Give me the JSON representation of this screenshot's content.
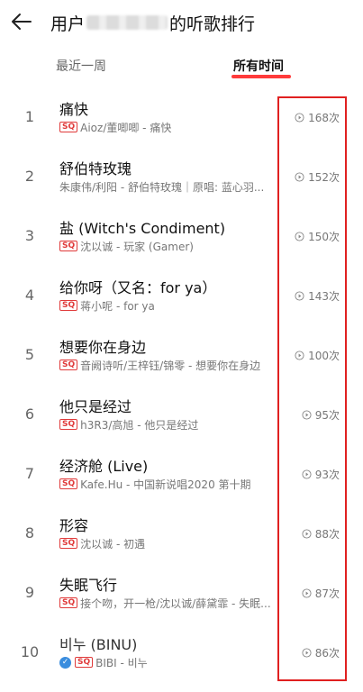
{
  "header": {
    "title_prefix": "用户",
    "title_suffix": "的听歌排行"
  },
  "tabs": [
    {
      "label": "最近一周",
      "active": false
    },
    {
      "label": "所有时间",
      "active": true
    }
  ],
  "songs": [
    {
      "rank": "1",
      "title": "痛快",
      "subtitle": "Aioz/董唧唧 - 痛快",
      "plays": "168次",
      "sq": "SQ"
    },
    {
      "rank": "2",
      "title": "舒伯特玫瑰",
      "subtitle": "朱康伟/利阳 - 舒伯特玫瑰｜原唱: 蓝心羽...",
      "plays": "152次",
      "sq": ""
    },
    {
      "rank": "3",
      "title": "盐 (Witch's Condiment)",
      "subtitle": "沈以诚 - 玩家 (Gamer)",
      "plays": "150次",
      "sq": "SQ"
    },
    {
      "rank": "4",
      "title": "给你呀（又名：for ya）",
      "subtitle": "蒋小呢 - for ya",
      "plays": "143次",
      "sq": "SQ"
    },
    {
      "rank": "5",
      "title": "想要你在身边",
      "subtitle": "音阙诗听/王梓钰/锦零 - 想要你在身边",
      "plays": "100次",
      "sq": "SQ"
    },
    {
      "rank": "6",
      "title": "他只是经过",
      "subtitle": "h3R3/高旭 - 他只是经过",
      "plays": "95次",
      "sq": "SQ"
    },
    {
      "rank": "7",
      "title": "经济舱 (Live)",
      "subtitle": "Kafe.Hu - 中国新说唱2020 第十期",
      "plays": "93次",
      "sq": "SQ"
    },
    {
      "rank": "8",
      "title": "形容",
      "subtitle": "沈以诚 - 初遇",
      "plays": "88次",
      "sq": "SQ"
    },
    {
      "rank": "9",
      "title": "失眠飞行",
      "subtitle": "接个吻，开一枪/沈以诚/薛黛霏 - 失眠...",
      "plays": "87次",
      "sq": "SQ"
    },
    {
      "rank": "10",
      "title": "비누 (BINU)",
      "subtitle": "BIBI - 비누",
      "plays": "86次",
      "sq": "SQ",
      "verified": true
    }
  ],
  "colors": {
    "accent": "#ff3b3b",
    "sq_badge": "#e03a3a",
    "highlight_box": "#e02020",
    "verified_badge": "#3a8dde"
  },
  "icons": {
    "back": "arrow-left-icon",
    "play": "play-circle-icon",
    "verified": "check-circle-icon"
  }
}
